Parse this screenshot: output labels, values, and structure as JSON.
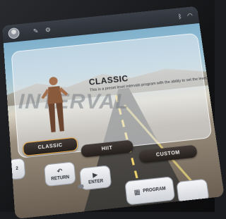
{
  "colors": {
    "accent": "#f3b24e",
    "button_dark": "#2a2420",
    "panel": "#e9ecef"
  },
  "header": {
    "user_label": "",
    "icons": [
      "avatar",
      "edit-icon",
      "settings-icon",
      "bluetooth-icon",
      "wifi-icon"
    ]
  },
  "program": {
    "watermark": "INTERVAL",
    "title": "CLASSIC",
    "description": "This is a preset level intervals program with the ability to set the level."
  },
  "buttons": {
    "classic": "CLASSIC",
    "hiit": "HIIT",
    "custom": "CUSTOM"
  },
  "controls": {
    "left_label": "2",
    "return_label": "RETURN",
    "enter_label": "ENTER",
    "program_label": "PROGRAM"
  }
}
